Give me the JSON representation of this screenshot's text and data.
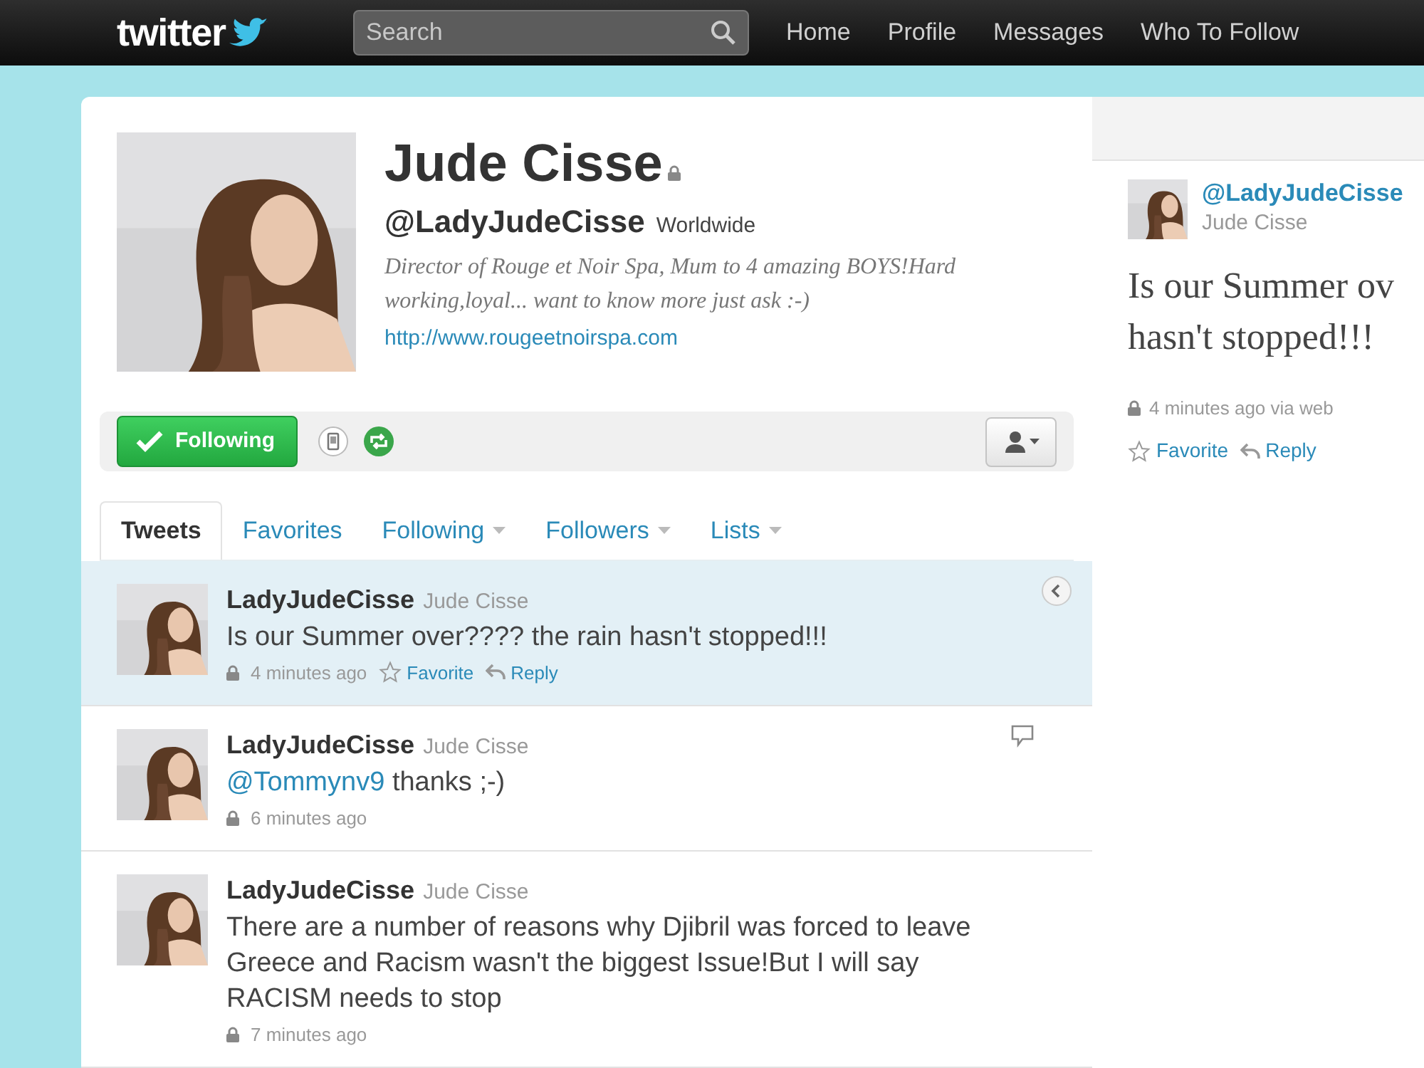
{
  "header": {
    "logo": "twitter",
    "search": {
      "placeholder": "Search"
    },
    "nav": [
      "Home",
      "Profile",
      "Messages",
      "Who To Follow"
    ]
  },
  "profile": {
    "name": "Jude Cisse",
    "protected": true,
    "handle": "@LadyJudeCisse",
    "location": "Worldwide",
    "bio": "Director of Rouge et Noir Spa, Mum to 4 amazing BOYS!Hard working,loyal... want to know more just ask :-)",
    "url": "http://www.rougeetnoirspa.com"
  },
  "actions": {
    "follow_button": {
      "label": "Following",
      "following": true
    }
  },
  "tabs": [
    {
      "label": "Tweets",
      "selected": true,
      "dropdown": false
    },
    {
      "label": "Favorites",
      "selected": false,
      "dropdown": false
    },
    {
      "label": "Following",
      "selected": false,
      "dropdown": true
    },
    {
      "label": "Followers",
      "selected": false,
      "dropdown": true
    },
    {
      "label": "Lists",
      "selected": false,
      "dropdown": true
    }
  ],
  "tweets": [
    {
      "username": "LadyJudeCisse",
      "name": "Jude Cisse",
      "text": "Is our Summer over???? the rain hasn't stopped!!!",
      "time": "4 minutes ago",
      "protected": true,
      "selected": true,
      "corner_icon": {
        "kind": "expand"
      },
      "actions": [
        {
          "kind": "favorite",
          "label": "Favorite"
        },
        {
          "kind": "reply",
          "label": "Reply"
        }
      ]
    },
    {
      "username": "LadyJudeCisse",
      "name": "Jude Cisse",
      "mention": "@Tommynv9",
      "text": "thanks ;-)",
      "time": "6 minutes ago",
      "protected": true,
      "selected": false,
      "corner_icon": {
        "kind": "reply-bubble"
      }
    },
    {
      "username": "LadyJudeCisse",
      "name": "Jude Cisse",
      "text": "There are a number of reasons why Djibril was forced to leave Greece and Racism wasn't the biggest Issue!But I will say RACISM needs to stop",
      "time": "7 minutes ago",
      "protected": true,
      "selected": false
    }
  ],
  "detail": {
    "handle": "@LadyJudeCisse",
    "name": "Jude Cisse",
    "text_lines": [
      "Is our Summer ov",
      "hasn't stopped!!!"
    ],
    "protected": true,
    "meta": "4 minutes ago via web",
    "actions": [
      {
        "kind": "favorite",
        "label": "Favorite"
      },
      {
        "kind": "reply",
        "label": "Reply"
      }
    ]
  }
}
